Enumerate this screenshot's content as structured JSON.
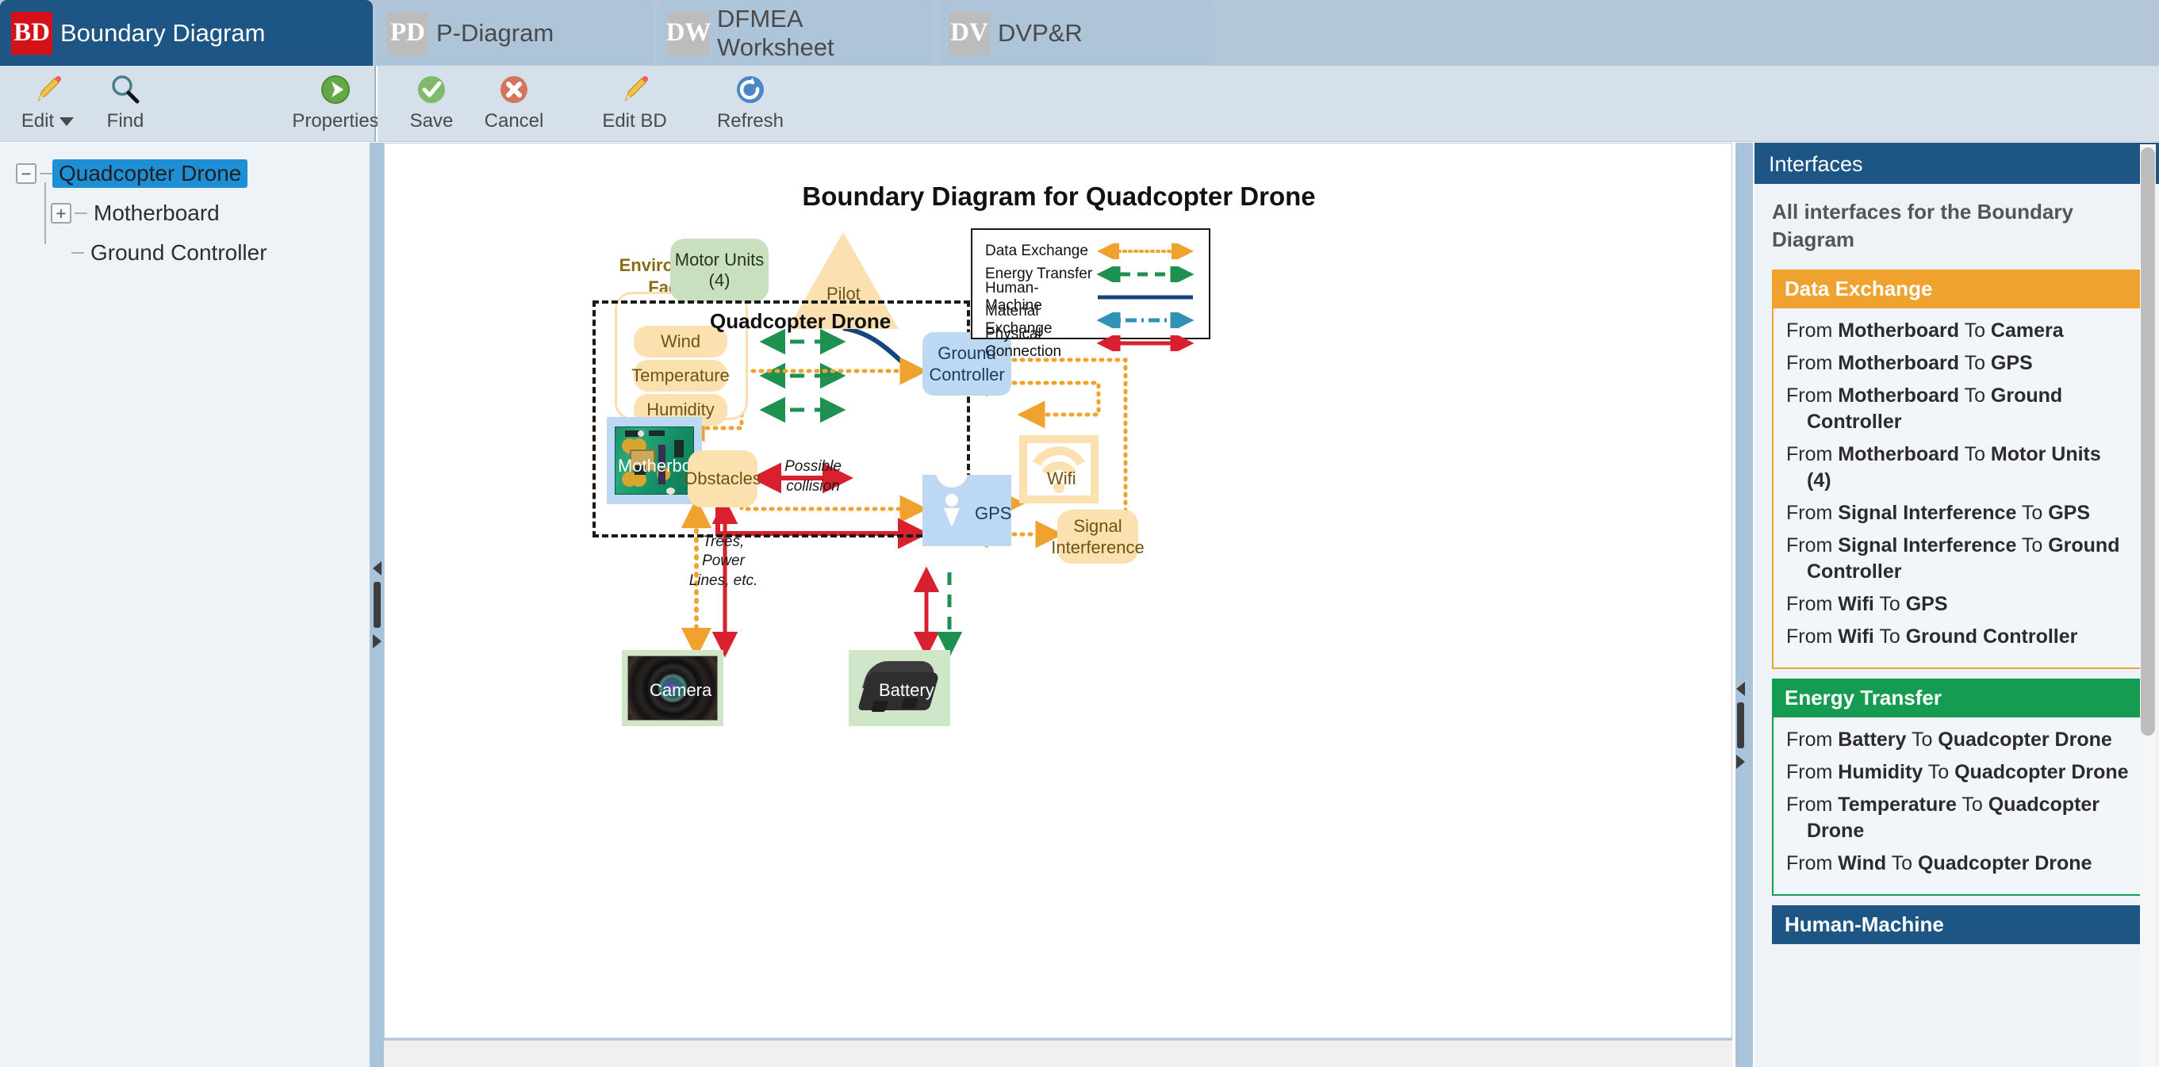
{
  "tabs": [
    {
      "badge": "BD",
      "label": "Boundary Diagram",
      "active": true
    },
    {
      "badge": "PD",
      "label": "P-Diagram",
      "active": false
    },
    {
      "badge": "DW",
      "label": "DFMEA Worksheet",
      "active": false
    },
    {
      "badge": "DV",
      "label": "DVP&R",
      "active": false
    }
  ],
  "toolbar_left": {
    "edit": "Edit",
    "find": "Find",
    "properties": "Properties"
  },
  "toolbar_right": {
    "save": "Save",
    "cancel": "Cancel",
    "edit_bd": "Edit BD",
    "refresh": "Refresh"
  },
  "tree": {
    "root": "Quadcopter Drone",
    "children": [
      "Motherboard",
      "Ground Controller"
    ],
    "root_expander": "−",
    "child_expander": "+"
  },
  "diagram": {
    "title": "Boundary Diagram for Quadcopter Drone",
    "boundary_label": "Quadcopter Drone",
    "env_title": "Environmental\nFactors",
    "nodes": {
      "motor_units": "Motor Units\n(4)",
      "pilot": "Pilot",
      "wind": "Wind",
      "temperature": "Temperature",
      "humidity": "Humidity",
      "motherboard": "Motherboard",
      "ground_controller": "Ground\nController",
      "gps": "GPS",
      "wifi": "Wifi",
      "signal_interference": "Signal\nInterference",
      "obstacles": "Obstacles",
      "camera": "Camera",
      "battery": "Battery"
    },
    "annotations": {
      "possible_collision": "Possible collision",
      "obstacles_caption": "Trees, Power\nLines, etc."
    },
    "legend": [
      {
        "name": "Data Exchange",
        "color": "#f0a22e",
        "style": "dotted",
        "arrows": "both"
      },
      {
        "name": "Energy Transfer",
        "color": "#1e9150",
        "style": "dashed",
        "arrows": "both"
      },
      {
        "name": "Human-Machine",
        "color": "#13447e",
        "style": "solid",
        "arrows": "none"
      },
      {
        "name": "Material Exchange",
        "color": "#3192b8",
        "style": "dashdot",
        "arrows": "both"
      },
      {
        "name": "Physical Connection",
        "color": "#d9202e",
        "style": "solid",
        "arrows": "both"
      }
    ]
  },
  "interfaces": {
    "header": "Interfaces",
    "subtitle": "All interfaces for the Boundary Diagram",
    "groups": [
      {
        "title": "Data Exchange",
        "color": "#f0a22e",
        "items": [
          {
            "from": "Motherboard",
            "to": "Camera"
          },
          {
            "from": "Motherboard",
            "to": "GPS"
          },
          {
            "from": "Motherboard",
            "to": "Ground Controller"
          },
          {
            "from": "Motherboard",
            "to": "Motor Units (4)"
          },
          {
            "from": "Signal Interference",
            "to": "GPS"
          },
          {
            "from": "Signal Interference",
            "to": "Ground Controller"
          },
          {
            "from": "Wifi",
            "to": "GPS"
          },
          {
            "from": "Wifi",
            "to": "Ground Controller"
          }
        ]
      },
      {
        "title": "Energy Transfer",
        "color": "#169b52",
        "items": [
          {
            "from": "Battery",
            "to": "Quadcopter Drone"
          },
          {
            "from": "Humidity",
            "to": "Quadcopter Drone"
          },
          {
            "from": "Temperature",
            "to": "Quadcopter Drone"
          },
          {
            "from": "Wind",
            "to": "Quadcopter Drone"
          }
        ]
      },
      {
        "title": "Human-Machine",
        "color": "#1d5584",
        "items": []
      }
    ],
    "word_from": "From",
    "word_to": "To"
  },
  "colors": {
    "accent_blue": "#1d5584",
    "tab_bar": "#b3c7d9",
    "toolbar": "#d6e0ea",
    "selection": "#1e8fd5",
    "data_exchange": "#f0a22e",
    "energy_transfer": "#169b52",
    "physical_connection": "#d9202e",
    "human_machine": "#13447e",
    "material_exchange": "#3192b8"
  }
}
